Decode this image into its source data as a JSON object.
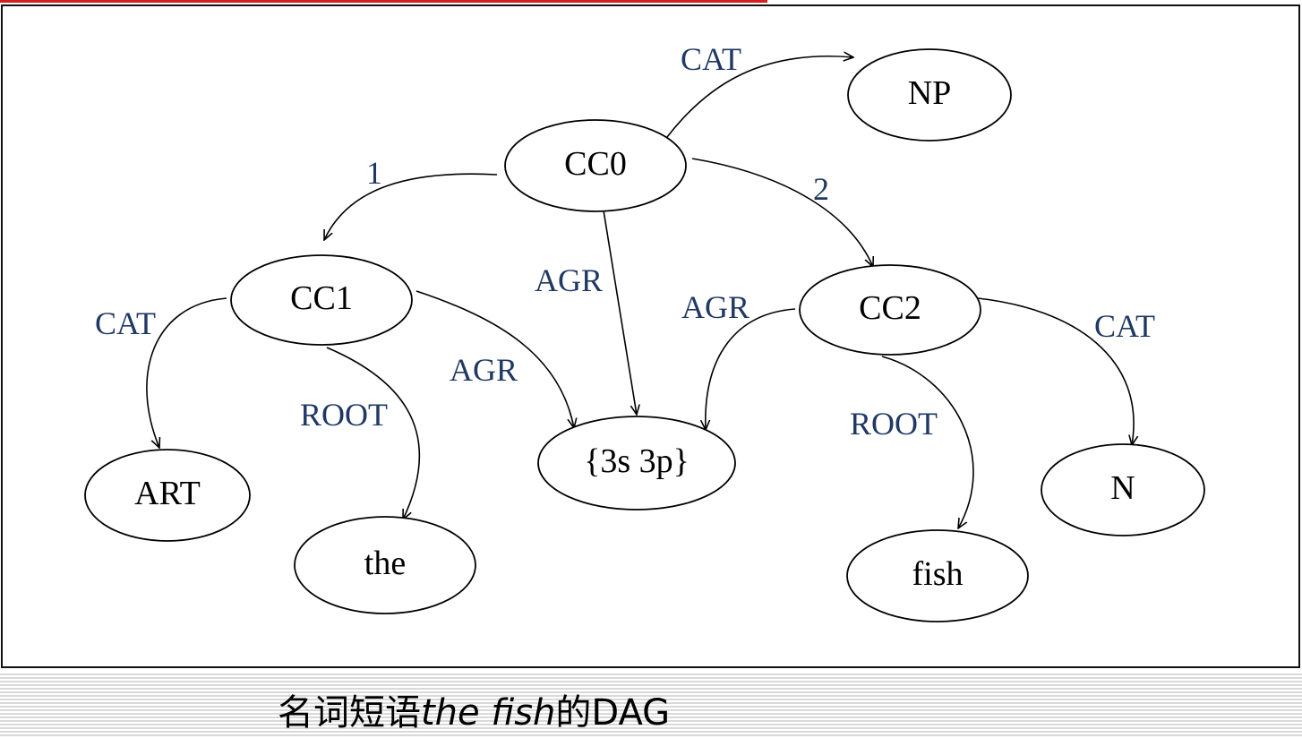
{
  "diagram": {
    "nodes": [
      {
        "id": "CC0",
        "label": "CC0"
      },
      {
        "id": "NP",
        "label": "NP"
      },
      {
        "id": "CC1",
        "label": "CC1"
      },
      {
        "id": "CC2",
        "label": "CC2"
      },
      {
        "id": "AGRVAL",
        "label": "{3s 3p}"
      },
      {
        "id": "ART",
        "label": "ART"
      },
      {
        "id": "THE",
        "label": "the"
      },
      {
        "id": "FISH",
        "label": "fish"
      },
      {
        "id": "N",
        "label": "N"
      }
    ],
    "edges": [
      {
        "from": "CC0",
        "to": "NP",
        "label": "CAT"
      },
      {
        "from": "CC0",
        "to": "CC1",
        "label": "1"
      },
      {
        "from": "CC0",
        "to": "CC2",
        "label": "2"
      },
      {
        "from": "CC0",
        "to": "AGRVAL",
        "label": "AGR"
      },
      {
        "from": "CC1",
        "to": "ART",
        "label": "CAT"
      },
      {
        "from": "CC1",
        "to": "THE",
        "label": "ROOT"
      },
      {
        "from": "CC1",
        "to": "AGRVAL",
        "label": "AGR"
      },
      {
        "from": "CC2",
        "to": "AGRVAL",
        "label": "AGR"
      },
      {
        "from": "CC2",
        "to": "FISH",
        "label": "ROOT"
      },
      {
        "from": "CC2",
        "to": "N",
        "label": "CAT"
      }
    ]
  },
  "caption": {
    "prefix": "名词短语",
    "phrase": "the fish",
    "suffix": "的DAG"
  },
  "colors": {
    "edge_label": "#1f3864",
    "accent_bar": "#d41f1f"
  }
}
